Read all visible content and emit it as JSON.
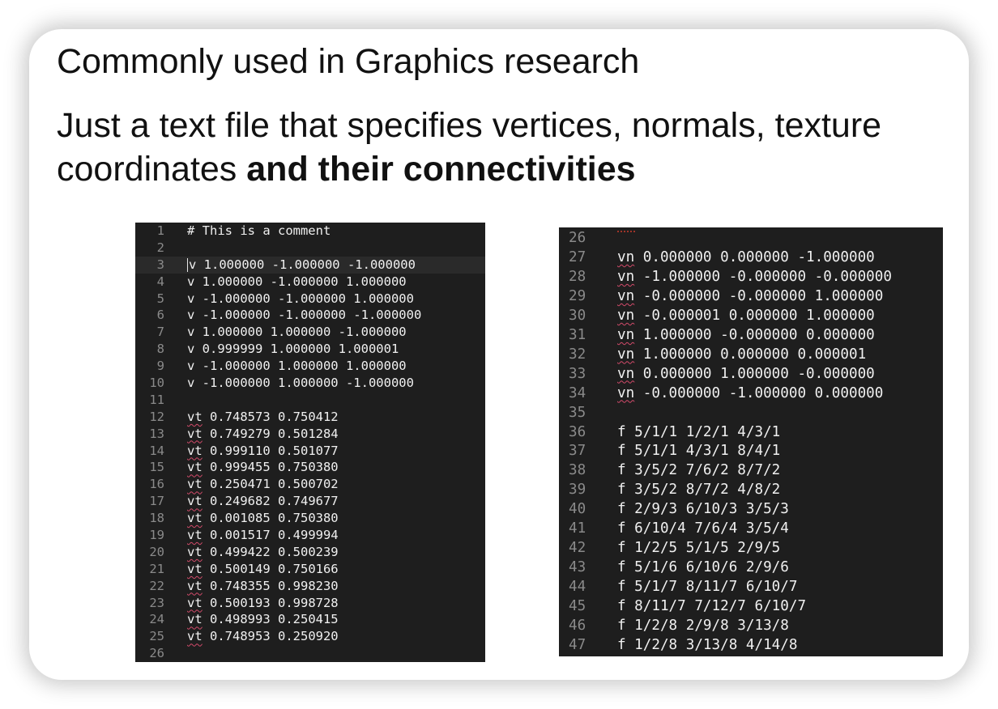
{
  "slide": {
    "title": "Commonly used in Graphics research",
    "body_plain": "Just a text file that specifies vertices, normals, texture coordinates ",
    "body_bold": "and their connectivities"
  },
  "left_editor": {
    "current_line": 3,
    "lines": [
      {
        "num": "1",
        "prefix": "",
        "rest": "# This is a comment"
      },
      {
        "num": "2",
        "prefix": "",
        "rest": ""
      },
      {
        "num": "3",
        "prefix": "",
        "rest": "v 1.000000 -1.000000 -1.000000"
      },
      {
        "num": "4",
        "prefix": "",
        "rest": "v 1.000000 -1.000000 1.000000"
      },
      {
        "num": "5",
        "prefix": "",
        "rest": "v -1.000000 -1.000000 1.000000"
      },
      {
        "num": "6",
        "prefix": "",
        "rest": "v -1.000000 -1.000000 -1.000000"
      },
      {
        "num": "7",
        "prefix": "",
        "rest": "v 1.000000 1.000000 -1.000000"
      },
      {
        "num": "8",
        "prefix": "",
        "rest": "v 0.999999 1.000000 1.000001"
      },
      {
        "num": "9",
        "prefix": "",
        "rest": "v -1.000000 1.000000 1.000000"
      },
      {
        "num": "10",
        "prefix": "",
        "rest": "v -1.000000 1.000000 -1.000000"
      },
      {
        "num": "11",
        "prefix": "",
        "rest": ""
      },
      {
        "num": "12",
        "prefix": "vt",
        "rest": " 0.748573 0.750412"
      },
      {
        "num": "13",
        "prefix": "vt",
        "rest": " 0.749279 0.501284"
      },
      {
        "num": "14",
        "prefix": "vt",
        "rest": " 0.999110 0.501077"
      },
      {
        "num": "15",
        "prefix": "vt",
        "rest": " 0.999455 0.750380"
      },
      {
        "num": "16",
        "prefix": "vt",
        "rest": " 0.250471 0.500702"
      },
      {
        "num": "17",
        "prefix": "vt",
        "rest": " 0.249682 0.749677"
      },
      {
        "num": "18",
        "prefix": "vt",
        "rest": " 0.001085 0.750380"
      },
      {
        "num": "19",
        "prefix": "vt",
        "rest": " 0.001517 0.499994"
      },
      {
        "num": "20",
        "prefix": "vt",
        "rest": " 0.499422 0.500239"
      },
      {
        "num": "21",
        "prefix": "vt",
        "rest": " 0.500149 0.750166"
      },
      {
        "num": "22",
        "prefix": "vt",
        "rest": " 0.748355 0.998230"
      },
      {
        "num": "23",
        "prefix": "vt",
        "rest": " 0.500193 0.998728"
      },
      {
        "num": "24",
        "prefix": "vt",
        "rest": " 0.498993 0.250415"
      },
      {
        "num": "25",
        "prefix": "vt",
        "rest": " 0.748953 0.250920"
      },
      {
        "num": "26",
        "prefix": "",
        "rest": ""
      }
    ]
  },
  "right_editor": {
    "lines": [
      {
        "num": "26",
        "prefix": "",
        "rest": ""
      },
      {
        "num": "27",
        "prefix": "vn",
        "rest": " 0.000000 0.000000 -1.000000"
      },
      {
        "num": "28",
        "prefix": "vn",
        "rest": " -1.000000 -0.000000 -0.000000"
      },
      {
        "num": "29",
        "prefix": "vn",
        "rest": " -0.000000 -0.000000 1.000000"
      },
      {
        "num": "30",
        "prefix": "vn",
        "rest": " -0.000001 0.000000 1.000000"
      },
      {
        "num": "31",
        "prefix": "vn",
        "rest": " 1.000000 -0.000000 0.000000"
      },
      {
        "num": "32",
        "prefix": "vn",
        "rest": " 1.000000 0.000000 0.000001"
      },
      {
        "num": "33",
        "prefix": "vn",
        "rest": " 0.000000 1.000000 -0.000000"
      },
      {
        "num": "34",
        "prefix": "vn",
        "rest": " -0.000000 -1.000000 0.000000"
      },
      {
        "num": "35",
        "prefix": "",
        "rest": ""
      },
      {
        "num": "36",
        "prefix": "",
        "rest": "f 5/1/1 1/2/1 4/3/1"
      },
      {
        "num": "37",
        "prefix": "",
        "rest": "f 5/1/1 4/3/1 8/4/1"
      },
      {
        "num": "38",
        "prefix": "",
        "rest": "f 3/5/2 7/6/2 8/7/2"
      },
      {
        "num": "39",
        "prefix": "",
        "rest": "f 3/5/2 8/7/2 4/8/2"
      },
      {
        "num": "40",
        "prefix": "",
        "rest": "f 2/9/3 6/10/3 3/5/3"
      },
      {
        "num": "41",
        "prefix": "",
        "rest": "f 6/10/4 7/6/4 3/5/4"
      },
      {
        "num": "42",
        "prefix": "",
        "rest": "f 1/2/5 5/1/5 2/9/5"
      },
      {
        "num": "43",
        "prefix": "",
        "rest": "f 5/1/6 6/10/6 2/9/6"
      },
      {
        "num": "44",
        "prefix": "",
        "rest": "f 5/1/7 8/11/7 6/10/7"
      },
      {
        "num": "45",
        "prefix": "",
        "rest": "f 8/11/7 7/12/7 6/10/7"
      },
      {
        "num": "46",
        "prefix": "",
        "rest": "f 1/2/8 2/9/8 3/13/8"
      },
      {
        "num": "47",
        "prefix": "",
        "rest": "f 1/2/8 3/13/8 4/14/8"
      }
    ]
  },
  "colors": {
    "editor_bg": "#1e1e1e",
    "line_number": "#8a8a8a",
    "code_text": "#f0f0f0",
    "spell_underline": "#d24a6a"
  }
}
